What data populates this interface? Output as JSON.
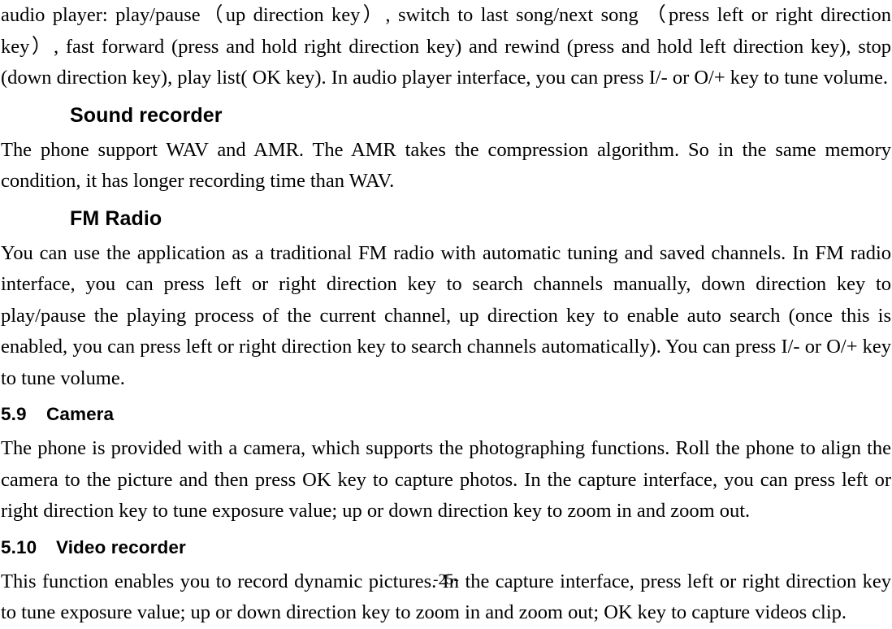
{
  "document": {
    "page_number_label": "-25-",
    "sections": [
      {
        "id": "audio-player-continued",
        "paragraph": "audio player: play/pause（up direction key）, switch to last song/next song （press left or right direction key）, fast forward (press and hold right direction key) and rewind (press and hold left direction key), stop (down direction key), play list( OK key). In audio player interface, you can press I/- or O/+ key to tune volume."
      },
      {
        "id": "sound-recorder",
        "heading": "Sound recorder",
        "paragraph": "The phone support WAV and AMR. The AMR takes the compression algorithm. So in the same memory condition, it has longer recording time than WAV."
      },
      {
        "id": "fm-radio",
        "heading": "FM Radio",
        "paragraph": "You can use the application as a traditional FM radio with automatic tuning and saved channels. In FM radio interface, you can press left or right direction key to search channels manually, down direction key to play/pause the playing process of the current channel, up direction key to enable auto search (once this is enabled, you can press left or right direction key to search channels automatically). You can press I/- or O/+ key to tune volume."
      },
      {
        "id": "camera",
        "number": "5.9",
        "heading": "Camera",
        "paragraph": "The phone is provided with a camera, which supports the photographing functions. Roll the phone to align the camera to the picture and then press OK key to capture photos. In the capture interface, you can press left or right direction key to tune exposure value; up or down direction key to zoom in and zoom out."
      },
      {
        "id": "video-recorder",
        "number": "5.10",
        "heading": "Video recorder",
        "paragraph": "This function enables you to record dynamic pictures. In the capture interface, press left or right direction key to tune exposure value; up or down direction key to zoom in and zoom out; OK key to capture videos clip."
      }
    ]
  }
}
